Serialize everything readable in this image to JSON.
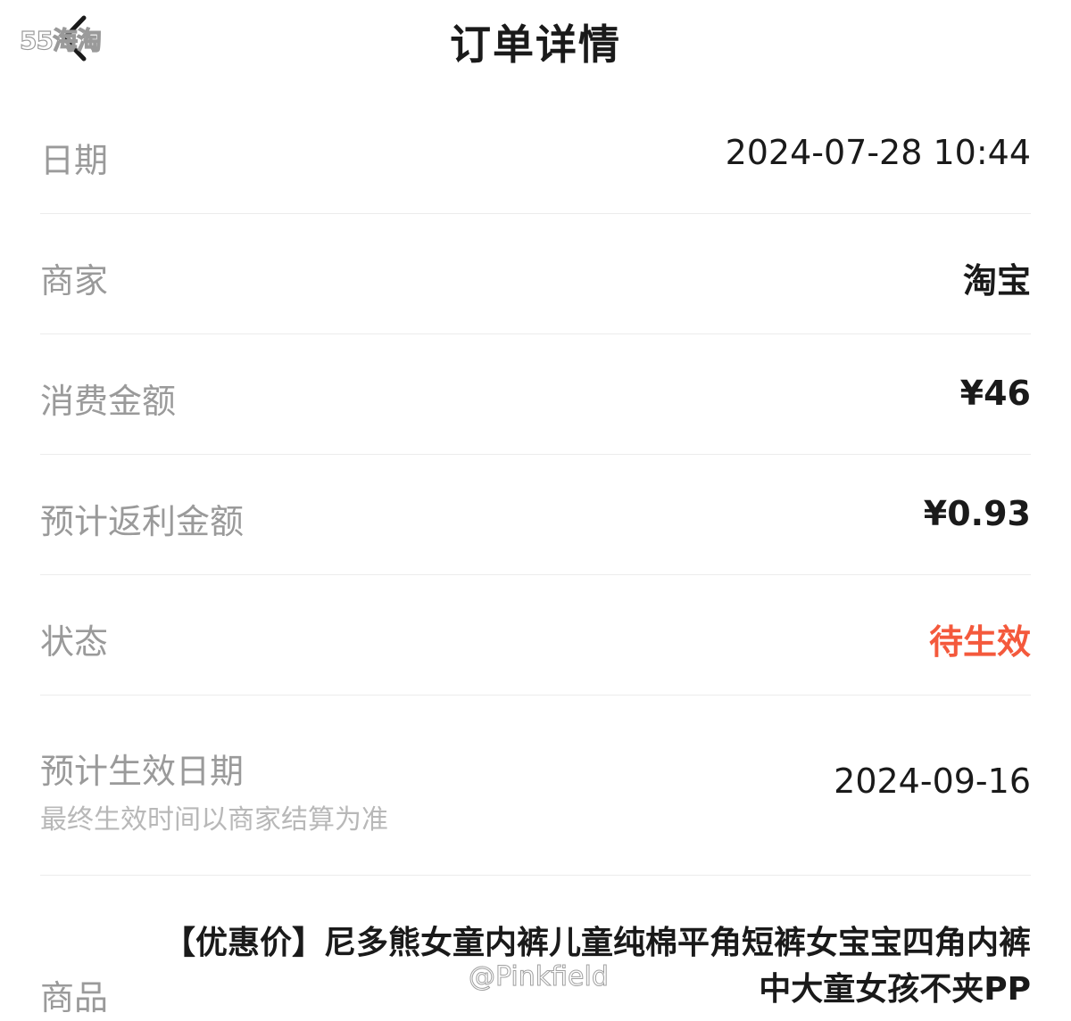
{
  "nav": {
    "title": "订单详情",
    "watermark": "55海淘"
  },
  "rows": {
    "date": {
      "label": "日期",
      "value": "2024-07-28 10:44"
    },
    "merchant": {
      "label": "商家",
      "value": "淘宝"
    },
    "amount": {
      "label": "消费金额",
      "value": "¥46"
    },
    "rebate": {
      "label": "预计返利金额",
      "value": "¥0.93"
    },
    "status": {
      "label": "状态",
      "value": "待生效"
    },
    "effective": {
      "label": "预计生效日期",
      "note": "最终生效时间以商家结算为准",
      "value": "2024-09-16"
    },
    "product": {
      "label": "商品",
      "value": "【优惠价】尼多熊女童内裤儿童纯棉平角短裤女宝宝四角内裤中大童女孩不夹PP"
    }
  },
  "watermark_bottom": "@Pinkfield",
  "colors": {
    "status": "#f4593c",
    "label": "#9a9a9a",
    "text": "#1a1a1a"
  },
  "icons": {
    "back": "chevron-left-icon"
  }
}
